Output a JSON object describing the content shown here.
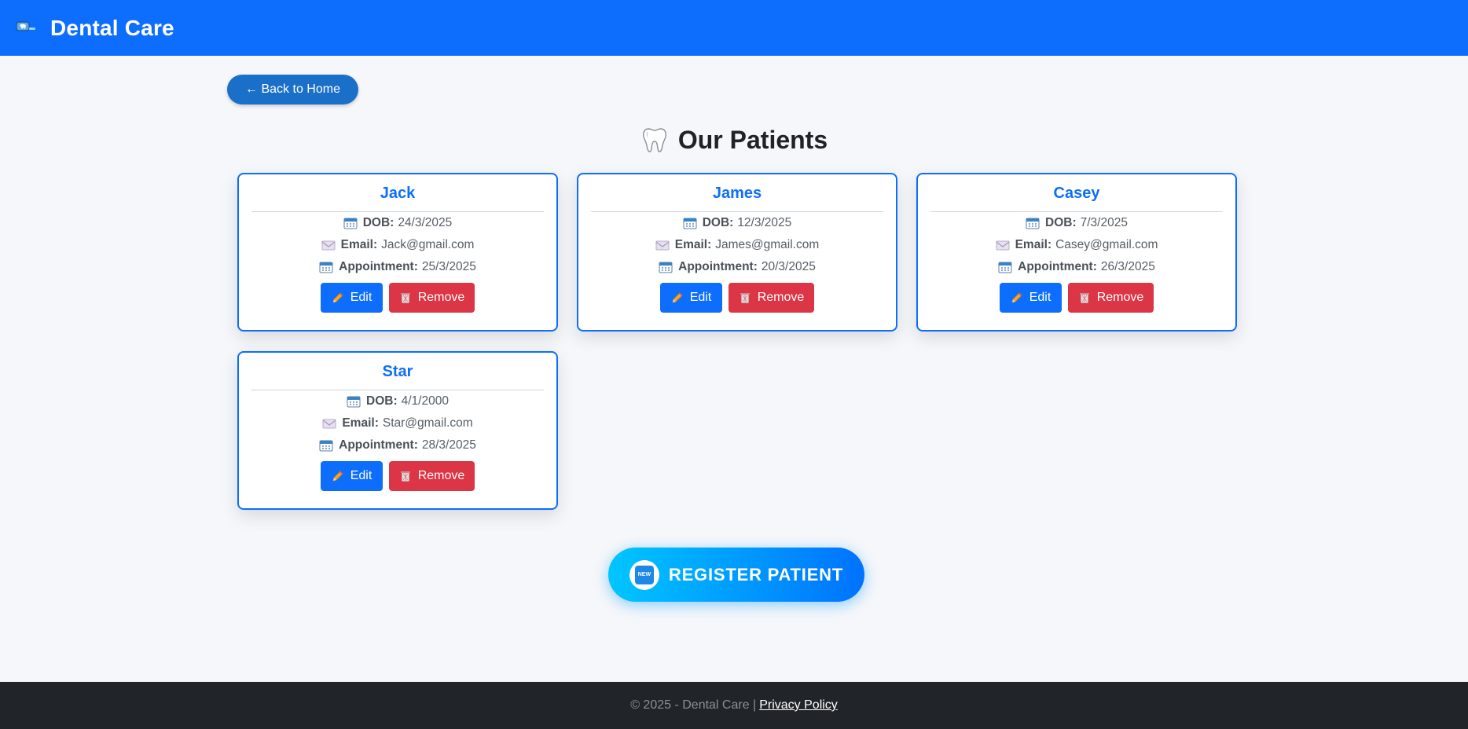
{
  "navbar": {
    "brand_title": "Dental Care",
    "logo_icon": "tooth-logo-icon",
    "color": "#0d6efd"
  },
  "back_button": {
    "label": "← Back to Home"
  },
  "heading": {
    "icon": "tooth-icon",
    "text": "Our Patients"
  },
  "labels": {
    "dob": "DOB:",
    "email": "Email:",
    "appointment": "Appointment:",
    "edit": "Edit",
    "remove": "Remove"
  },
  "patients": [
    {
      "name": "Jack",
      "dob": "24/3/2025",
      "email": "Jack@gmail.com",
      "appointment": "25/3/2025"
    },
    {
      "name": "James",
      "dob": "12/3/2025",
      "email": "James@gmail.com",
      "appointment": "20/3/2025"
    },
    {
      "name": "Casey",
      "dob": "7/3/2025",
      "email": "Casey@gmail.com",
      "appointment": "26/3/2025"
    },
    {
      "name": "Star",
      "dob": "4/1/2000",
      "email": "Star@gmail.com",
      "appointment": "28/3/2025"
    }
  ],
  "register_button": {
    "label": "REGISTER PATIENT",
    "badge": "NEW"
  },
  "footer": {
    "text": "© 2025 - Dental Care |",
    "link": "Privacy Policy"
  },
  "colors": {
    "primary": "#0d6efd",
    "danger": "#dc3545",
    "footer_bg": "#212529"
  }
}
